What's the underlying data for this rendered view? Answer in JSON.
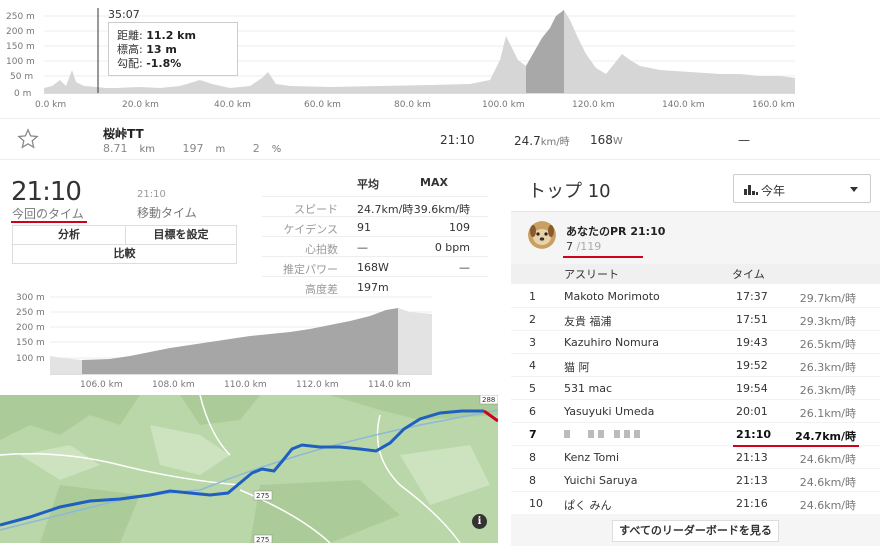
{
  "top_elevation": {
    "y_ticks": [
      "250 m",
      "200 m",
      "150 m",
      "100 m",
      "50 m",
      "0 m"
    ],
    "x_ticks": [
      "0.0 km",
      "20.0 km",
      "40.0 km",
      "60.0 km",
      "80.0 km",
      "100.0 km",
      "120.0 km",
      "140.0 km",
      "160.0 km"
    ],
    "cursor_time": "35:07",
    "tooltip": {
      "distance_label": "距離: ",
      "distance_value": "11.2 km",
      "elevation_label": "標高: ",
      "elevation_value": "13 m",
      "grade_label": "勾配: ",
      "grade_value": "-1.8%"
    }
  },
  "segment": {
    "name": "桜峠TT",
    "distance": "8.71",
    "distance_unit": "km",
    "elev_gain": "197",
    "elev_unit": "m",
    "grade": "2",
    "grade_unit": "%",
    "time": "21:10",
    "speed": "24.7",
    "speed_unit": "km/時",
    "power": "168",
    "power_unit": "W",
    "dash": "—"
  },
  "summary": {
    "time": "21:10",
    "time_label": "今回のタイム",
    "moving_time": "21:10",
    "moving_label": "移動タイム",
    "buttons": {
      "analysis": "分析",
      "goal": "目標を設定",
      "compare": "比較"
    }
  },
  "stats": {
    "avg_header": "平均",
    "max_header": "MAX",
    "rows": [
      {
        "label": "スピード",
        "avg": "24.7km/時",
        "max": "39.6km/時"
      },
      {
        "label": "ケイデンス",
        "avg": "91",
        "max": "109"
      },
      {
        "label": "心拍数",
        "avg": "—",
        "max": "0 bpm"
      },
      {
        "label": "推定パワー",
        "avg": "168W",
        "max": "—"
      },
      {
        "label": "高度差",
        "avg": "197m",
        "max": ""
      }
    ]
  },
  "sub_elevation": {
    "y_ticks": [
      "300 m",
      "250 m",
      "200 m",
      "150 m",
      "100 m"
    ],
    "x_ticks": [
      "106.0 km",
      "108.0 km",
      "110.0 km",
      "112.0 km",
      "114.0 km"
    ]
  },
  "map": {
    "route_labels": [
      "275",
      "275",
      "288"
    ],
    "info_glyph": "i"
  },
  "leaderboard": {
    "title": "トップ 10",
    "filter_label": "今年",
    "pr_title": "あなたのPR 21:10",
    "pr_rank": "7",
    "pr_total": " /119",
    "col_athlete": "アスリート",
    "col_time": "タイム",
    "rows": [
      {
        "rank": "1",
        "name": "Makoto Morimoto",
        "time": "17:37",
        "speed": "29.7km/時"
      },
      {
        "rank": "2",
        "name": "友貴 福浦",
        "time": "17:51",
        "speed": "29.3km/時"
      },
      {
        "rank": "3",
        "name": "Kazuhiro Nomura",
        "time": "19:43",
        "speed": "26.5km/時"
      },
      {
        "rank": "4",
        "name": "猫 阿",
        "time": "19:52",
        "speed": "26.3km/時"
      },
      {
        "rank": "5",
        "name": "531 mac",
        "time": "19:54",
        "speed": "26.3km/時"
      },
      {
        "rank": "6",
        "name": "Yasuyuki Umeda",
        "time": "20:01",
        "speed": "26.1km/時"
      },
      {
        "rank": "7",
        "name": "",
        "time": "21:10",
        "speed": "24.7km/時",
        "me": true
      },
      {
        "rank": "8",
        "name": "Kenz Tomi",
        "time": "21:13",
        "speed": "24.6km/時"
      },
      {
        "rank": "8",
        "name": "Yuichi Saruya",
        "time": "21:13",
        "speed": "24.6km/時"
      },
      {
        "rank": "10",
        "name": "ぱく みん",
        "time": "21:16",
        "speed": "24.6km/時"
      }
    ],
    "view_all": "すべてのリーダーボードを見る"
  },
  "colors": {
    "accent_red": "#d0021b",
    "route_blue": "#1f5fbf",
    "map_green": "#b9d7a8"
  }
}
